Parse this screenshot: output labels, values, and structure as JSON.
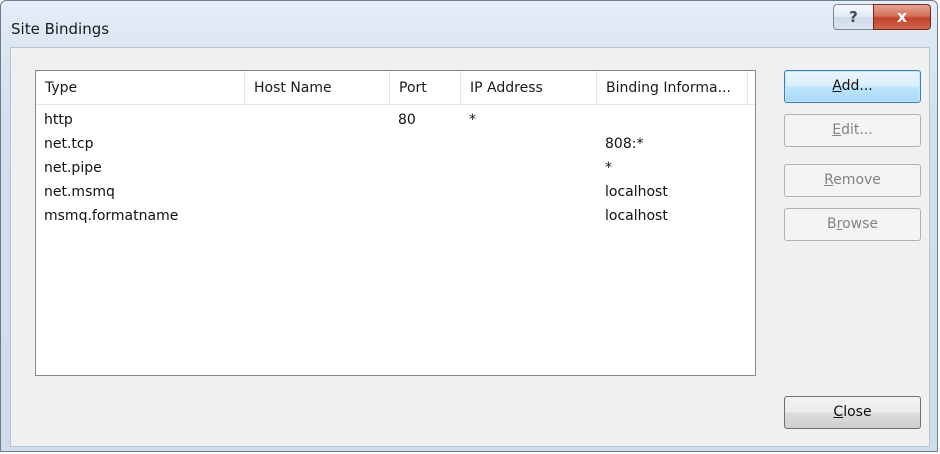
{
  "window": {
    "title": "Site Bindings",
    "help_glyph": "?",
    "close_glyph": "x"
  },
  "listview": {
    "columns": [
      "Type",
      "Host Name",
      "Port",
      "IP Address",
      "Binding Informa..."
    ],
    "rows": [
      {
        "type": "http",
        "host": "",
        "port": "80",
        "ip": "*",
        "binding": ""
      },
      {
        "type": "net.tcp",
        "host": "",
        "port": "",
        "ip": "",
        "binding": "808:*"
      },
      {
        "type": "net.pipe",
        "host": "",
        "port": "",
        "ip": "",
        "binding": "*"
      },
      {
        "type": "net.msmq",
        "host": "",
        "port": "",
        "ip": "",
        "binding": "localhost"
      },
      {
        "type": "msmq.formatname",
        "host": "",
        "port": "",
        "ip": "",
        "binding": "localhost"
      }
    ]
  },
  "buttons": {
    "add": {
      "mnemonic": "A",
      "rest": "dd...",
      "enabled": true
    },
    "edit": {
      "mnemonic": "E",
      "rest": "dit...",
      "enabled": false
    },
    "remove": {
      "mnemonic": "R",
      "rest": "emove",
      "enabled": false
    },
    "browse_pre": "B",
    "browse_mnemonic": "r",
    "browse_rest": "owse",
    "close": {
      "mnemonic": "C",
      "rest": "lose",
      "enabled": true
    }
  }
}
